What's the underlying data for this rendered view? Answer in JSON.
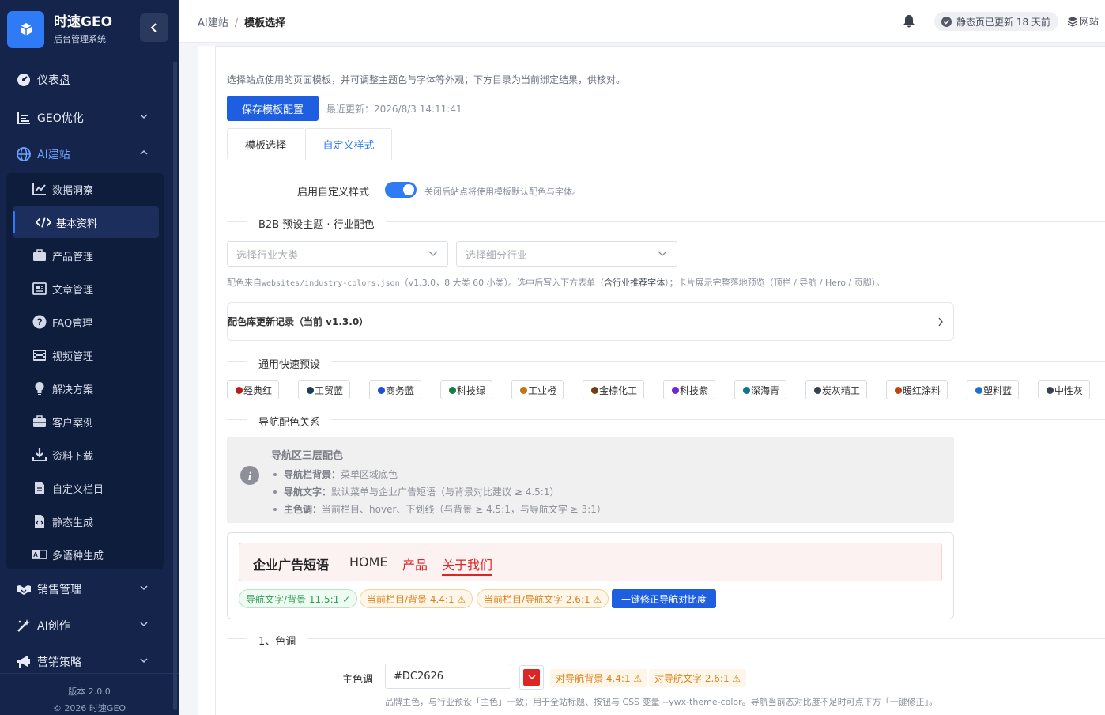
{
  "app": {
    "title": "时速GEO",
    "subtitle": "后台管理系统",
    "version": "版本 2.0.0",
    "copyright": "© 2026 时速GEO"
  },
  "sidebar": {
    "menus": [
      {
        "label": "仪表盘",
        "icon": "dashboard-icon"
      },
      {
        "label": "GEO优化",
        "icon": "list-icon"
      },
      {
        "label": "AI建站",
        "icon": "globe-icon"
      },
      {
        "label": "销售管理",
        "icon": "handshake-icon"
      },
      {
        "label": "AI创作",
        "icon": "magic-wand-icon"
      },
      {
        "label": "营销策略",
        "icon": "megaphone-icon"
      }
    ],
    "submenu": [
      {
        "label": "数据洞察",
        "icon": "chart-line-icon"
      },
      {
        "label": "基本资料",
        "icon": "code-icon"
      },
      {
        "label": "产品管理",
        "icon": "briefcase-icon"
      },
      {
        "label": "文章管理",
        "icon": "newspaper-icon"
      },
      {
        "label": "FAQ管理",
        "icon": "question-circle-icon"
      },
      {
        "label": "视频管理",
        "icon": "film-icon"
      },
      {
        "label": "解决方案",
        "icon": "lightbulb-icon"
      },
      {
        "label": "客户案例",
        "icon": "case-icon"
      },
      {
        "label": "资料下载",
        "icon": "download-icon"
      },
      {
        "label": "自定义栏目",
        "icon": "file-icon"
      },
      {
        "label": "静态生成",
        "icon": "file-code-icon"
      },
      {
        "label": "多语种生成",
        "icon": "language-icon"
      }
    ]
  },
  "header": {
    "breadcrumb": [
      "AI建站",
      "模板选择"
    ],
    "status": "静态页已更新 18 天前",
    "site": "网站"
  },
  "main": {
    "description": "选择站点使用的页面模板，并可调整主题色与字体等外观；下方目录为当前绑定结果，供核对。",
    "save_button": "保存模板配置",
    "updated": "最近更新：2026/8/3 14:11:41",
    "tabs": [
      "模板选择",
      "自定义样式"
    ],
    "toggle_label": "启用自定义样式",
    "toggle_on": true,
    "toggle_help": "关闭后站点将使用模板默认配色与字体。",
    "section_presets": "B2B 预设主题 · 行业配色",
    "select_category_placeholder": "选择行业大类",
    "select_sub_placeholder": "选择细分行业",
    "note_prefix": "配色来自",
    "note_file": "websites/industry-colors.json",
    "note_mid": "（v1.3.0，8 大类 60 小类）。选中后写入下方表单（",
    "note_bold": "含行业推荐字体",
    "note_suffix": "）；卡片展示完整落地预览（顶栏 / 导航 / Hero / 页脚）。",
    "changelog": "配色库更新记录（当前 v1.3.0）",
    "section_quick": "通用快速预设",
    "presets": [
      {
        "label": "经典红",
        "color": "#b91c1c"
      },
      {
        "label": "工贸蓝",
        "color": "#1e3a5f"
      },
      {
        "label": "商务蓝",
        "color": "#1d4ed8"
      },
      {
        "label": "科技绿",
        "color": "#15803d"
      },
      {
        "label": "工业橙",
        "color": "#c2770e"
      },
      {
        "label": "金棕化工",
        "color": "#713f12"
      },
      {
        "label": "科技紫",
        "color": "#6d28d9"
      },
      {
        "label": "深海青",
        "color": "#0e7490"
      },
      {
        "label": "炭灰精工",
        "color": "#374151"
      },
      {
        "label": "暖红涂料",
        "color": "#c2410c"
      },
      {
        "label": "塑料蓝",
        "color": "#1d6fd1"
      },
      {
        "label": "中性灰",
        "color": "#374151"
      }
    ],
    "section_nav": "导航配色关系",
    "info": {
      "title": "导航区三层配色",
      "items": [
        {
          "key": "导航栏背景：",
          "text": "菜单区域底色"
        },
        {
          "key": "导航文字：",
          "text": "默认菜单与企业广告短语（与背景对比建议 ≥ 4.5:1）"
        },
        {
          "key": "主色调：",
          "text": "当前栏目、hover、下划线（与背景 ≥ 4.5:1，与导航文字 ≥ 3:1）"
        }
      ]
    },
    "preview": {
      "brand": "企业广告短语",
      "links": [
        "HOME",
        "产品",
        "关于我们"
      ],
      "badges": [
        "导航文字/背景 11.5:1 ✓",
        "当前栏目/背景 4.4:1 ⚠",
        "当前栏目/导航文字 2.6:1 ⚠"
      ],
      "fix_button": "一键修正导航对比度"
    },
    "section_tone": "1、色调",
    "primary_label": "主色调",
    "primary_value": "#DC2626",
    "primary_tags": [
      "对导航背景 4.4:1 ⚠",
      "对导航文字 2.6:1 ⚠"
    ],
    "primary_help": "品牌主色，与行业预设「主色」一致；用于全站标题、按钮与 CSS 变量 --ywx-theme-color。导航当前态对比度不足时可点下方「一键修正」。"
  },
  "colors": {
    "accent": "#1d5fe0",
    "sidebar": "#14244a",
    "primary": "#dc2626"
  }
}
